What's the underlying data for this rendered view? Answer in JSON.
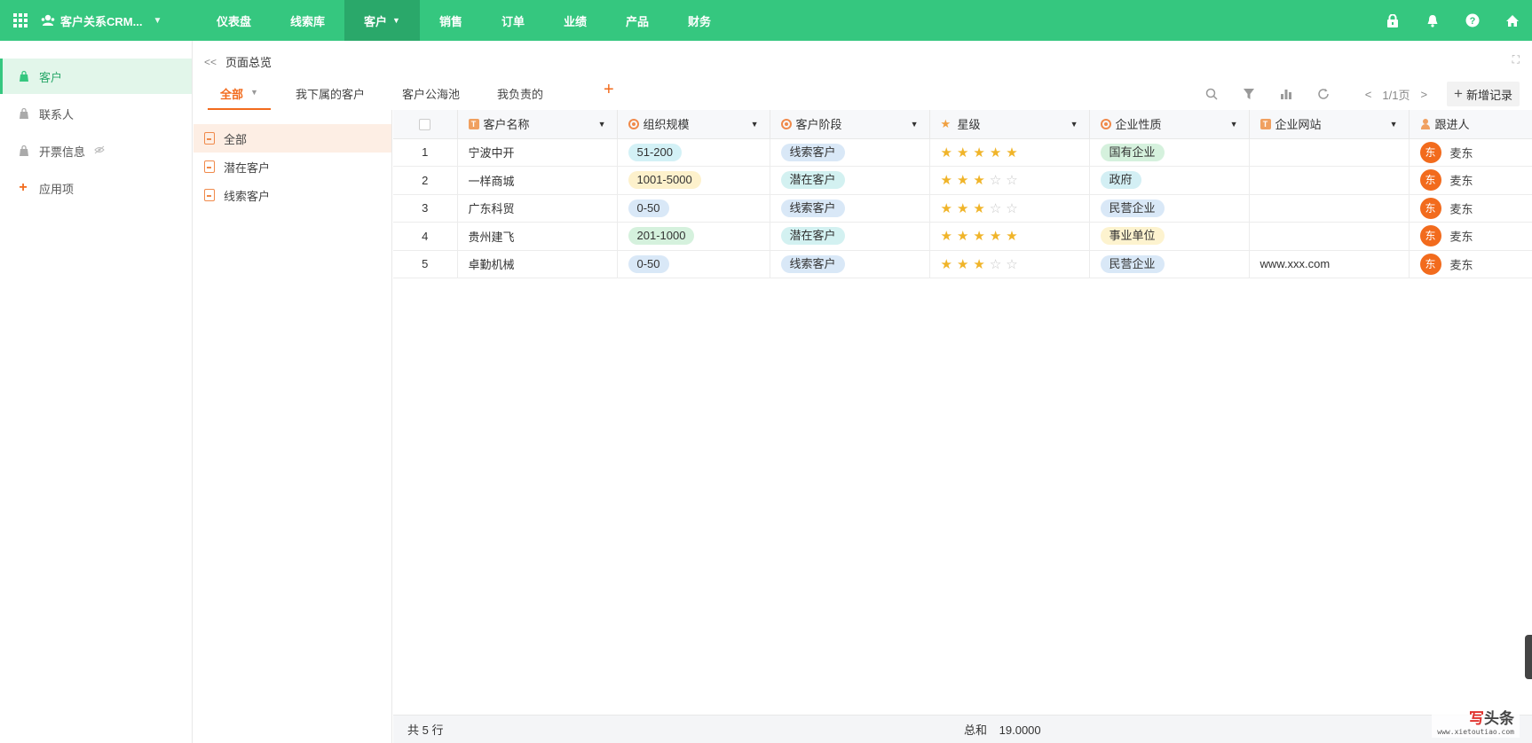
{
  "app": {
    "name": "客户关系CRM..."
  },
  "nav": [
    {
      "label": "仪表盘",
      "active": false,
      "caret": ""
    },
    {
      "label": "线索库",
      "active": false,
      "caret": ""
    },
    {
      "label": "客户",
      "active": true,
      "caret": "▼"
    },
    {
      "label": "销售",
      "active": false,
      "caret": ""
    },
    {
      "label": "订单",
      "active": false,
      "caret": ""
    },
    {
      "label": "业绩",
      "active": false,
      "caret": ""
    },
    {
      "label": "产品",
      "active": false,
      "caret": ""
    },
    {
      "label": "财务",
      "active": false,
      "caret": ""
    }
  ],
  "sidebar": {
    "items": [
      {
        "label": "客户",
        "active": true
      },
      {
        "label": "联系人",
        "active": false
      },
      {
        "label": "开票信息",
        "active": false
      }
    ],
    "add_label": "应用项"
  },
  "page": {
    "title": "页面总览",
    "tabs": [
      {
        "label": "全部",
        "active": true,
        "caret": "▼"
      },
      {
        "label": "我下属的客户",
        "active": false,
        "caret": ""
      },
      {
        "label": "客户公海池",
        "active": false,
        "caret": ""
      },
      {
        "label": "我负责的",
        "active": false,
        "caret": ""
      }
    ],
    "pager": "1/1页",
    "add_record": "新增记录"
  },
  "filters": [
    {
      "label": "全部",
      "active": true
    },
    {
      "label": "潜在客户",
      "active": false
    },
    {
      "label": "线索客户",
      "active": false
    }
  ],
  "table": {
    "columns": [
      {
        "label": "客户名称",
        "icon": "text-field-icon"
      },
      {
        "label": "组织规模",
        "icon": "select-field-icon"
      },
      {
        "label": "客户阶段",
        "icon": "select-field-icon"
      },
      {
        "label": "星级",
        "icon": "star-field-icon"
      },
      {
        "label": "企业性质",
        "icon": "select-field-icon"
      },
      {
        "label": "企业网站",
        "icon": "text-field-icon"
      },
      {
        "label": "跟进人",
        "icon": "user-field-icon"
      }
    ],
    "rows": [
      {
        "no": "1",
        "name": "宁波中开",
        "scale": "51-200",
        "scale_color": "#d3f1f6",
        "stage": "线索客户",
        "stage_color": "#d9e8f7",
        "stars": 5,
        "nature": "国有企业",
        "nature_color": "#d5f1dd",
        "site": "",
        "avatar": "东",
        "owner": "麦东"
      },
      {
        "no": "2",
        "name": "一样商城",
        "scale": "1001-5000",
        "scale_color": "#fdf1cc",
        "stage": "潜在客户",
        "stage_color": "#d3f1f1",
        "stars": 3,
        "nature": "政府",
        "nature_color": "#d3eff4",
        "site": "",
        "avatar": "东",
        "owner": "麦东"
      },
      {
        "no": "3",
        "name": "广东科贸",
        "scale": "0-50",
        "scale_color": "#d9e8f7",
        "stage": "线索客户",
        "stage_color": "#d9e8f7",
        "stars": 3,
        "nature": "民营企业",
        "nature_color": "#d9e8f7",
        "site": "",
        "avatar": "东",
        "owner": "麦东"
      },
      {
        "no": "4",
        "name": "贵州建飞",
        "scale": "201-1000",
        "scale_color": "#d5f1dd",
        "stage": "潜在客户",
        "stage_color": "#d3f1f1",
        "stars": 5,
        "nature": "事业单位",
        "nature_color": "#fdf3cf",
        "site": "",
        "avatar": "东",
        "owner": "麦东"
      },
      {
        "no": "5",
        "name": "卓勤机械",
        "scale": "0-50",
        "scale_color": "#d9e8f7",
        "stage": "线索客户",
        "stage_color": "#d9e8f7",
        "stars": 3,
        "nature": "民营企业",
        "nature_color": "#d9e8f7",
        "site": "www.xxx.com",
        "avatar": "东",
        "owner": "麦东"
      }
    ]
  },
  "footer": {
    "rows_label": "共 5 行",
    "sum_label": "总和",
    "sum_value": "19.0000"
  },
  "watermark": {
    "line1_a": "写",
    "line1_b": "头条",
    "line2": "www.xietoutiao.com"
  },
  "colors": {
    "brand": "#35c77f",
    "accent": "#f26b1d",
    "star": "#f0b429"
  }
}
